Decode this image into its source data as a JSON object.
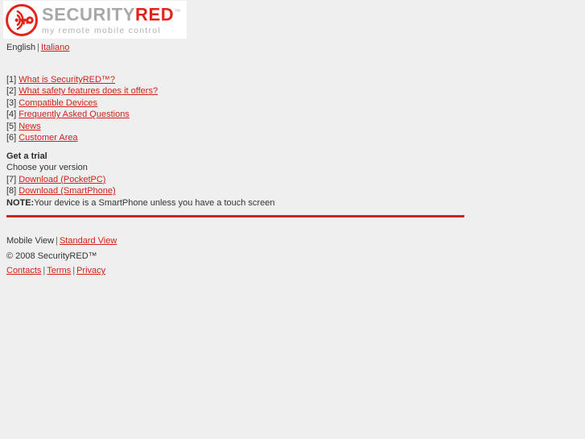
{
  "page": {
    "background_color": "#efeff0",
    "link_color": "#d0201b",
    "text_color": "#333333",
    "rule_color": "#d8201b"
  },
  "logo": {
    "icon_name": "securityred-signal-key-logo-icon",
    "word_part1": "SECURITY",
    "word_part2": "RED",
    "trademark": "™",
    "tagline": "my remote mobile control",
    "part1_color": "#a8a8a8",
    "part2_color": "#e2231a",
    "tagline_color": "#b0b0b0"
  },
  "language": {
    "current": "English",
    "separator": "|",
    "alternate": "Italiano"
  },
  "nav": {
    "items": [
      {
        "num": "[1]",
        "label": "What is SecurityRED™?"
      },
      {
        "num": "[2]",
        "label": "What safety features does it offers?"
      },
      {
        "num": "[3]",
        "label": "Compatible Devices"
      },
      {
        "num": "[4]",
        "label": "Frequently Asked Questions"
      },
      {
        "num": "[5]",
        "label": "News"
      },
      {
        "num": "[6]",
        "label": "Customer Area"
      }
    ]
  },
  "trial": {
    "heading": "Get a trial",
    "subheading": "Choose your version",
    "downloads": [
      {
        "num": "[7]",
        "label": "Download (PocketPC)"
      },
      {
        "num": "[8]",
        "label": "Download (SmartPhone)"
      }
    ],
    "note_label": "NOTE:",
    "note_text": "Your device is a SmartPhone unless you have a touch screen"
  },
  "footer": {
    "view_current": "Mobile View",
    "view_sep": "|",
    "view_alternate": "Standard View",
    "copyright": "© 2008 SecurityRED™",
    "links": [
      {
        "label": "Contacts"
      },
      {
        "label": "Terms"
      },
      {
        "label": "Privacy"
      }
    ],
    "link_sep": "|"
  }
}
